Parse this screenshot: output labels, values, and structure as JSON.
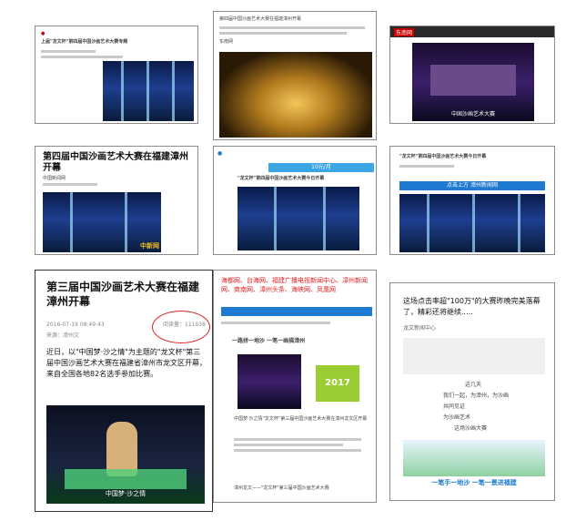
{
  "cards": {
    "c1": {
      "title": "上届\"龙文杯\"第四届中国沙画艺术大赛专题"
    },
    "c2": {
      "line1": "第四届中国沙画艺术大赛在福建漳州开幕",
      "credit": "东南网"
    },
    "c3": {
      "logo": "东南网",
      "caption": "中国沙画艺术大赛"
    },
    "c4": {
      "title": "第四届中国沙画艺术大赛在福建漳州开幕",
      "meta": "中国新闻网",
      "watermark": "中新网"
    },
    "c5": {
      "banner": "10元/月",
      "title": "\"龙文杯\"第四届中国沙画艺术大赛今日开幕"
    },
    "c6": {
      "title": "\"龙文杯\"第四届中国沙画艺术大赛今日开幕",
      "banner": "点击上方 漳州新闻网"
    },
    "c7": {
      "title": "第三届中国沙画艺术大赛在福建漳州开幕",
      "date": "2016-07-19 08:49:43",
      "reads": "阅读量：111038",
      "source": "来源：漳州文",
      "body": "近日，以\"中国梦·沙之情\"为主题的\"龙文杯\"第三届中国沙画艺术大赛在福建省漳州市龙文区开幕，来自全国各地82名选手参加比赛。",
      "photo_caption": "中国梦·沙之情"
    },
    "c8": {
      "red_text": "海都网、台海网、福建广播电视新闻中心、漳州新闻网、商南网、漳州头条、海峡网、凤凰网",
      "headline": "一路拼一地沙 一笔一画描漳州",
      "badge": "2017",
      "caption": "中国梦·沙之情\"龙文杯\"第三届中国沙画艺术大赛在漳州龙文区开幕",
      "footer": "漳州龙文——\"龙文杯\"第三届中国沙画艺术大赛"
    },
    "c9": {
      "title": "这场点击率超\"100万\"的大赛昨晚完美落幕了，精彩还将继续.....",
      "source": "龙文新闻中心",
      "lines": [
        "这几天",
        "我们一起，为漳州，为沙画",
        "共同见证",
        "为沙画艺术",
        "这场沙画大赛"
      ],
      "footer": "一笔手一地沙 一笔一景进福建"
    }
  }
}
